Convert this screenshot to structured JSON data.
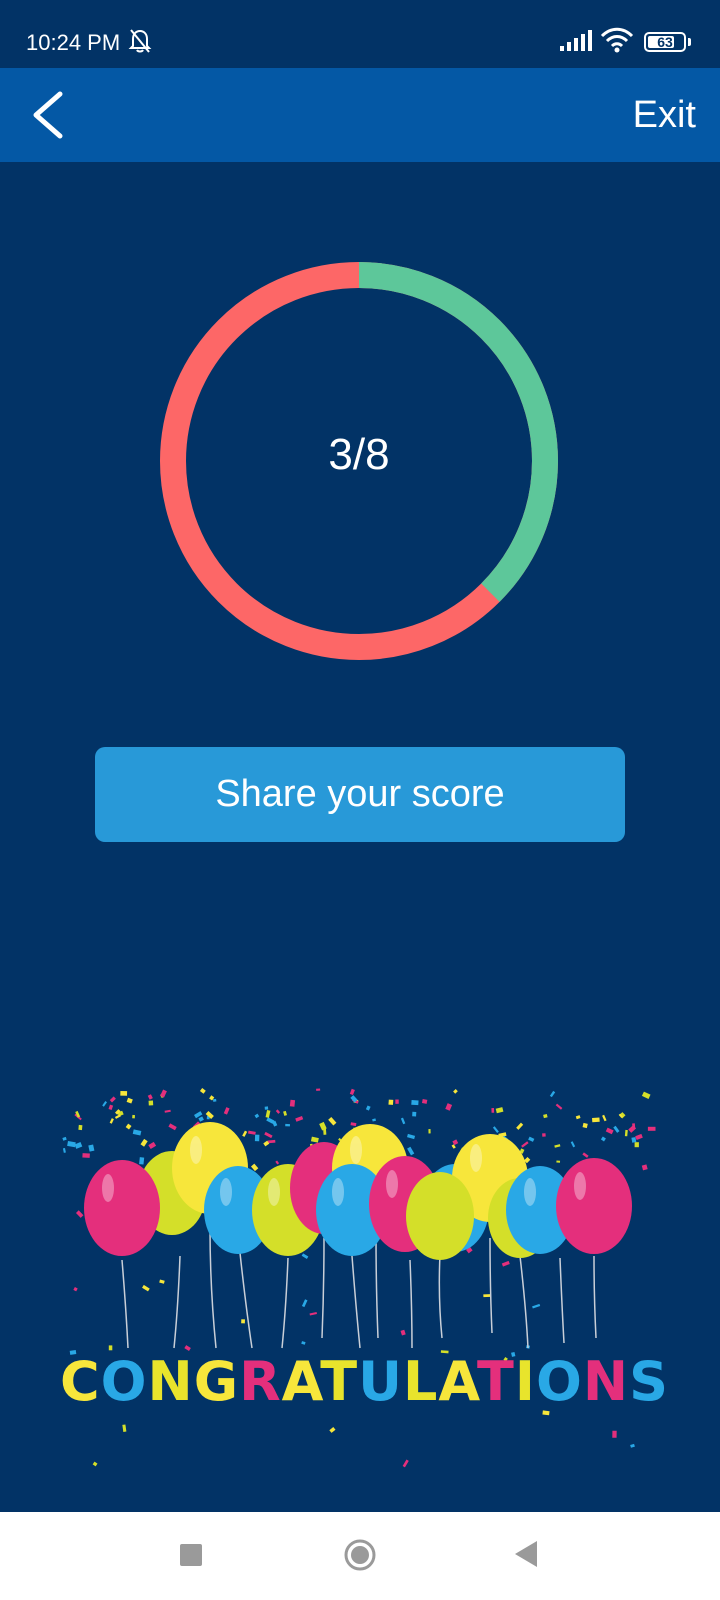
{
  "status_bar": {
    "time": "10:24 PM",
    "battery": "63"
  },
  "header": {
    "back_icon": "chevron-left-icon",
    "exit_label": "Exit"
  },
  "result": {
    "score_text": "3/8",
    "correct": 3,
    "total": 8,
    "correct_color": "#5dc79a",
    "wrong_color": "#fd6767"
  },
  "actions": {
    "share_label": "Share your score"
  },
  "banner": {
    "text": "CONGRATULATIONS",
    "letter_colors": [
      "#f7e63b",
      "#29a8e6",
      "#e8e42c",
      "#f7e63b",
      "#e42f7c",
      "#f7e63b",
      "#e8e42c",
      "#29a8e6",
      "#e8e42c",
      "#f7e63b",
      "#e42f7c",
      "#e8e42c",
      "#29a8e6",
      "#e42f7c",
      "#29a8e6"
    ]
  },
  "nav": {
    "recents_icon": "square-icon",
    "home_icon": "circle-home-icon",
    "back_icon": "triangle-back-icon"
  },
  "theme": {
    "background": "#023366",
    "appbar": "#0458a5",
    "button": "#2899d8"
  }
}
